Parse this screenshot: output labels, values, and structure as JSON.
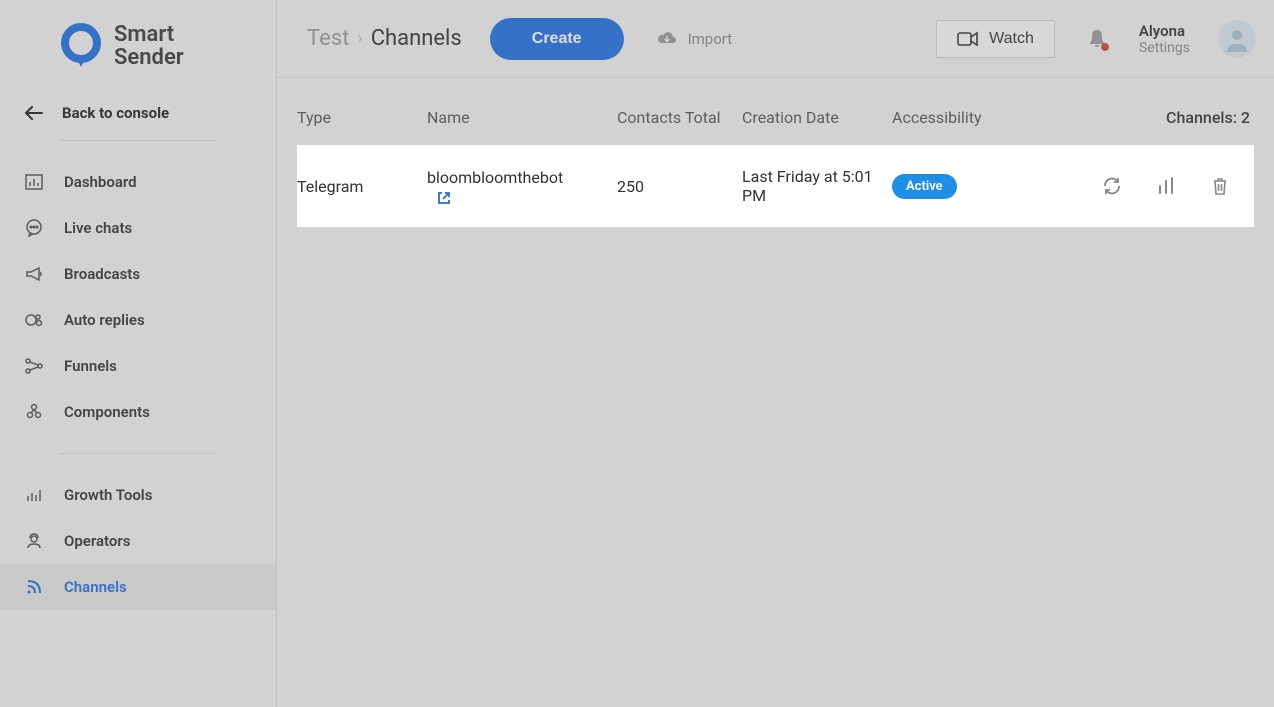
{
  "brand": {
    "line1": "Smart",
    "line2": "Sender"
  },
  "sidebar": {
    "back_label": "Back to console",
    "items": [
      {
        "label": "Dashboard"
      },
      {
        "label": "Live chats"
      },
      {
        "label": "Broadcasts"
      },
      {
        "label": "Auto replies"
      },
      {
        "label": "Funnels"
      },
      {
        "label": "Components"
      }
    ],
    "items2": [
      {
        "label": "Growth Tools"
      },
      {
        "label": "Operators"
      },
      {
        "label": "Channels"
      }
    ]
  },
  "header": {
    "breadcrumb_parent": "Test",
    "breadcrumb_current": "Channels",
    "create_label": "Create",
    "import_label": "Import",
    "watch_label": "Watch",
    "user_name": "Alyona",
    "user_settings": "Settings"
  },
  "table": {
    "cols": {
      "type": "Type",
      "name": "Name",
      "contacts": "Contacts Total",
      "creation": "Creation Date",
      "accessibility": "Accessibility"
    },
    "count_label": "Channels: 2",
    "rows": [
      {
        "type": "Telegram",
        "name": "bloombloomthebot",
        "contacts": "250",
        "creation": "Last Friday at 5:01 PM",
        "accessibility": "Active"
      }
    ]
  }
}
